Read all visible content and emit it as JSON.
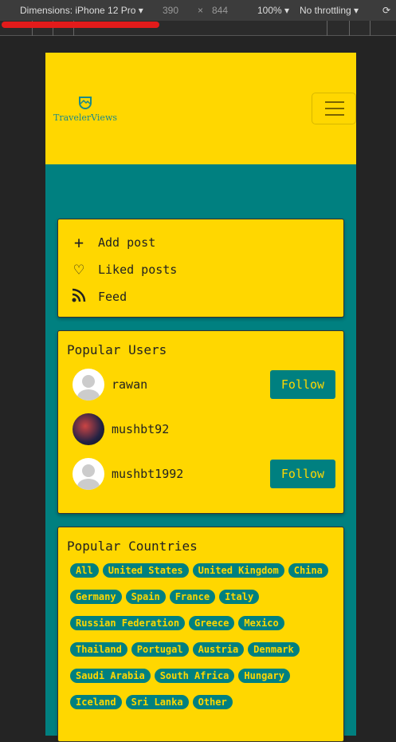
{
  "devtools": {
    "device": "Dimensions: iPhone 12 Pro ▾",
    "width": "390",
    "x": "×",
    "height": "844",
    "zoom": "100% ▾",
    "throttling": "No throttling ▾"
  },
  "header": {
    "brand": "TravelerViews"
  },
  "nav": [
    {
      "icon": "plus-icon",
      "glyph": "+",
      "label": "Add post"
    },
    {
      "icon": "heart-icon",
      "glyph": "♡",
      "label": "Liked posts"
    },
    {
      "icon": "rss-icon",
      "glyph": "◔",
      "label": "Feed"
    }
  ],
  "popular_users": {
    "title": "Popular Users",
    "users": [
      {
        "name": "rawan",
        "follow": "Follow"
      },
      {
        "name": "mushbt92"
      },
      {
        "name": "mushbt1992",
        "follow": "Follow"
      }
    ]
  },
  "popular_countries": {
    "title": "Popular Countries",
    "items": [
      "All",
      "United States",
      "United Kingdom",
      "China",
      "Germany",
      "Spain",
      "France",
      "Italy",
      "Russian Federation",
      "Greece",
      "Mexico",
      "Thailand",
      "Portugal",
      "Austria",
      "Denmark",
      "Saudi Arabia",
      "South Africa",
      "Hungary",
      "Iceland",
      "Sri Lanka",
      "Other"
    ]
  }
}
